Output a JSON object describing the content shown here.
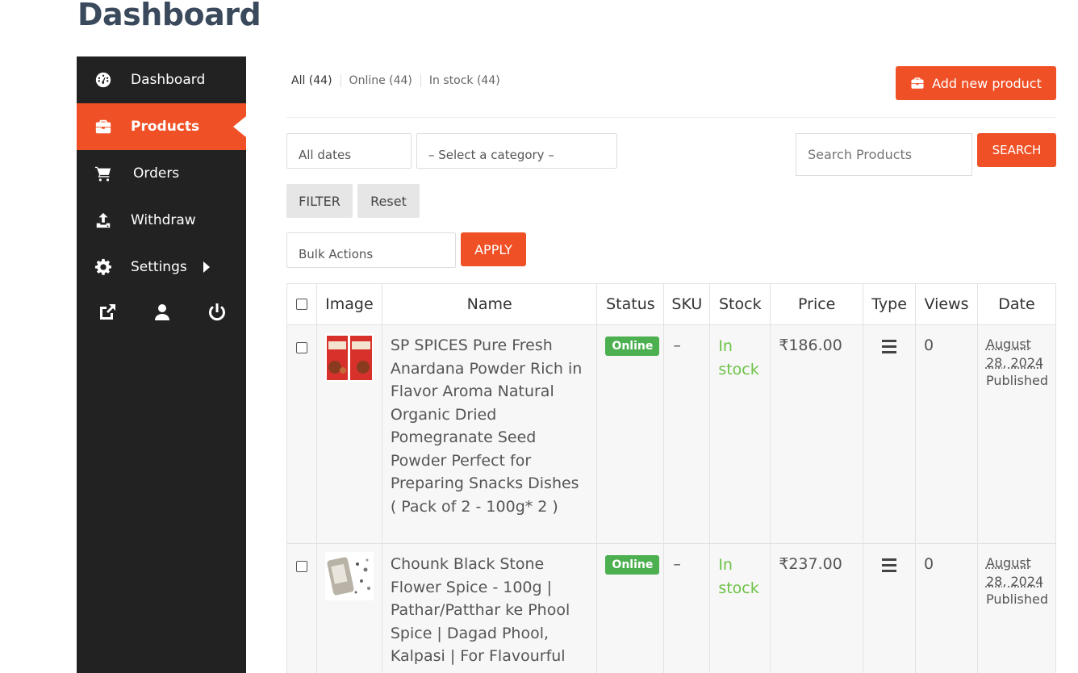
{
  "page_title": "Dashboard",
  "sidebar": {
    "items": [
      {
        "label": "Dashboard",
        "icon": "dashboard-icon"
      },
      {
        "label": "Products",
        "icon": "briefcase-icon",
        "active": true
      },
      {
        "label": "Orders",
        "icon": "cart-icon"
      },
      {
        "label": "Withdraw",
        "icon": "upload-icon"
      },
      {
        "label": "Settings",
        "icon": "gear-icon",
        "has_submenu": true
      }
    ],
    "bottom_icons": [
      "external-link-icon",
      "user-icon",
      "power-icon"
    ]
  },
  "status_tabs": [
    {
      "label": "All (44)"
    },
    {
      "label": "Online (44)"
    },
    {
      "label": "In stock (44)"
    }
  ],
  "add_button_label": "Add new product",
  "filters": {
    "dates_label": "All dates",
    "category_label": "– Select a category –",
    "search_placeholder": "Search Products",
    "search_button": "SEARCH",
    "filter_button": "FILTER",
    "reset_button": "Reset",
    "bulk_label": "Bulk Actions",
    "apply_button": "APPLY"
  },
  "table": {
    "headers": [
      "Image",
      "Name",
      "Status",
      "SKU",
      "Stock",
      "Price",
      "Type",
      "Views",
      "Date"
    ],
    "rows": [
      {
        "name": "SP SPICES Pure Fresh Anardana Powder Rich in Flavor Aroma Natural Organic Dried Pomegranate Seed Powder Perfect for Preparing Snacks Dishes ( Pack of 2 - 100g* 2 )",
        "status": "Online",
        "sku": "–",
        "stock": "In stock",
        "price": "₹186.00",
        "views": "0",
        "date": "August 28, 2024",
        "date_status": "Published"
      },
      {
        "name": "Chounk Black Stone Flower Spice - 100g | Pathar/Patthar ke Phool Spice | Dagad Phool, Kalpasi | For Flavourful Cooking",
        "status": "Online",
        "sku": "–",
        "stock": "In stock",
        "price": "₹237.00",
        "views": "0",
        "date": "August 28, 2024",
        "date_status": "Published"
      }
    ]
  },
  "colors": {
    "accent": "#f05025",
    "sidebar_bg": "#222222",
    "online_badge": "#4caf50",
    "in_stock": "#6dc247"
  }
}
